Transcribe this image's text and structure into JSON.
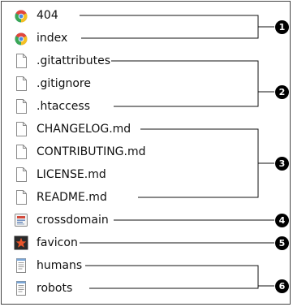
{
  "files": [
    {
      "name": "404",
      "icon": "chrome-html-icon"
    },
    {
      "name": "index",
      "icon": "chrome-html-icon"
    },
    {
      "name": ".gitattributes",
      "icon": "blank-file-icon"
    },
    {
      "name": ".gitignore",
      "icon": "blank-file-icon"
    },
    {
      "name": ".htaccess",
      "icon": "blank-file-icon"
    },
    {
      "name": "CHANGELOG.md",
      "icon": "blank-file-icon"
    },
    {
      "name": "CONTRIBUTING.md",
      "icon": "blank-file-icon"
    },
    {
      "name": "LICENSE.md",
      "icon": "blank-file-icon"
    },
    {
      "name": "README.md",
      "icon": "blank-file-icon"
    },
    {
      "name": "crossdomain",
      "icon": "xml-file-icon"
    },
    {
      "name": "favicon",
      "icon": "favicon-star-icon"
    },
    {
      "name": "humans",
      "icon": "text-file-icon"
    },
    {
      "name": "robots",
      "icon": "text-file-icon"
    }
  ],
  "groups": [
    {
      "label": "1"
    },
    {
      "label": "2"
    },
    {
      "label": "3"
    },
    {
      "label": "4"
    },
    {
      "label": "5"
    },
    {
      "label": "6"
    }
  ],
  "colors": {
    "wire": "#111111",
    "badge_bg": "#000000",
    "badge_text": "#ffffff"
  }
}
